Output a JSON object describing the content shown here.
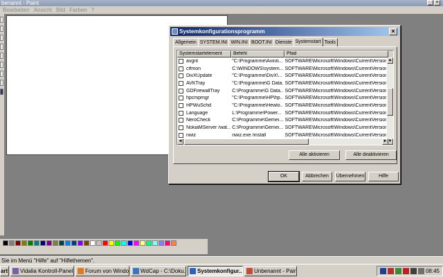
{
  "paint": {
    "title": "benannt - Paint",
    "menu": [
      "Bearbeiten",
      "Ansicht",
      "Bild",
      "Farben",
      "?"
    ],
    "status": "Sie im Menü \"Hilfe\" auf \"Hilfethemen\".",
    "palette": [
      "#000000",
      "#808080",
      "#800000",
      "#808000",
      "#008000",
      "#008080",
      "#000080",
      "#800080",
      "#808040",
      "#004040",
      "#0080ff",
      "#004080",
      "#8000ff",
      "#804000",
      "#ffffff",
      "#c0c0c0",
      "#ff0000",
      "#ffff00",
      "#00ff00",
      "#00ffff",
      "#0000ff",
      "#ff00ff",
      "#ffff80",
      "#00ff80",
      "#80ffff",
      "#8080ff",
      "#ff0080",
      "#ff8040"
    ]
  },
  "dialog": {
    "title": "Systemkonfigurationsprogramm",
    "close": "×",
    "tabs": [
      "Allgemein",
      "SYSTEM.INI",
      "WIN.INI",
      "BOOT.INI",
      "Dienste",
      "Systemstart",
      "Tools"
    ],
    "active_tab": 5,
    "columns": [
      "Systemstartelement",
      "Befehl",
      "Pfad"
    ],
    "rows": [
      {
        "name": "avgnt",
        "command": "\"C:\\Programme\\Avira\\...",
        "path": "SOFTWARE\\Microsoft\\Windows\\CurrentVersion\\..."
      },
      {
        "name": "ctfmon",
        "command": "C:\\WINDOWS\\system...",
        "path": "SOFTWARE\\Microsoft\\Windows\\CurrentVersion\\..."
      },
      {
        "name": "DivXUpdate",
        "command": "\"C:\\Programme\\DivX\\...",
        "path": "SOFTWARE\\Microsoft\\Windows\\CurrentVersion\\..."
      },
      {
        "name": "AVKTray",
        "command": "\"C:\\Programme\\G Data...",
        "path": "SOFTWARE\\Microsoft\\Windows\\CurrentVersion\\..."
      },
      {
        "name": "GDFirewallTray",
        "command": "C:\\Programme\\G Data...",
        "path": "SOFTWARE\\Microsoft\\Windows\\CurrentVersion\\..."
      },
      {
        "name": "hpcmpmgr",
        "command": "\"C:\\Programme\\HP\\hp...",
        "path": "SOFTWARE\\Microsoft\\Windows\\CurrentVersion\\..."
      },
      {
        "name": "HPWuSchd",
        "command": "\"C:\\Programme\\Hewlo...",
        "path": "SOFTWARE\\Microsoft\\Windows\\CurrentVersion\\..."
      },
      {
        "name": "Language",
        "command": "L:\\Programme\\Power...",
        "path": "SOFTWARE\\Microsoft\\Windows\\CurrentVersion\\..."
      },
      {
        "name": "NeroCheck",
        "command": "C:\\Programme\\Gemei...",
        "path": "SOFTWARE\\Microsoft\\Windows\\CurrentVersion\\..."
      },
      {
        "name": "NokiaMServer /wat...",
        "command": "C:\\Programme\\Gemei...",
        "path": "SOFTWARE\\Microsoft\\Windows\\CurrentVersion\\..."
      },
      {
        "name": "nwiz",
        "command": "nwiz.exe /install",
        "path": "SOFTWARE\\Microsoft\\Windows\\CurrentVersion\\..."
      },
      {
        "name": "OpwareSE4",
        "command": "\"C:\\Programme\\Scon...",
        "path": "SOFTWARE\\Microsoft\\Windows\\CurrentVersion\\..."
      }
    ],
    "buttons": {
      "enable_all": "Alle aktivieren",
      "disable_all": "Alle deaktivieren",
      "ok": "OK",
      "cancel": "Abbrechen",
      "apply": "Übernehmen",
      "help": "Hilfe"
    }
  },
  "taskbar": {
    "start": "art",
    "tasks": [
      {
        "label": "Vidalia Kontroll-Panel",
        "icon_color": "#7b5ea7",
        "active": false
      },
      {
        "label": "Forum von Windo...",
        "icon_color": "#e07a1f",
        "active": false
      },
      {
        "label": "WdCap - C:\\Doku...",
        "icon_color": "#3a74c4",
        "active": false
      },
      {
        "label": "Systemkonfigur...",
        "icon_color": "#2b62c0",
        "active": true
      },
      {
        "label": "Unbenannt - Paint",
        "icon_color": "#c44a3a",
        "active": false
      }
    ],
    "clock": "08:45",
    "tray_icons": [
      "#1c3f94",
      "#b43030",
      "#3a8a3a",
      "#c02020",
      "#404040",
      "#707070"
    ]
  }
}
